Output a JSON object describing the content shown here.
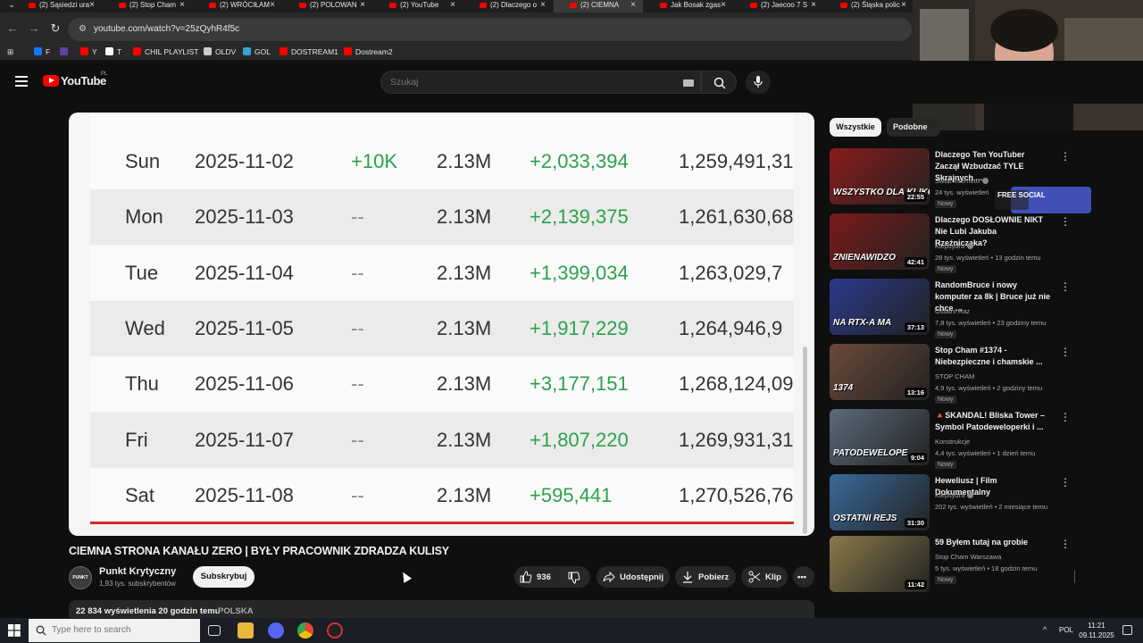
{
  "browser": {
    "tabs": [
      {
        "title": "(2) Sąsiedzi ura"
      },
      {
        "title": "(2) Stop Cham"
      },
      {
        "title": "(2) WRÓCIŁAM"
      },
      {
        "title": "(2) POLOWAN"
      },
      {
        "title": "(2) YouTube"
      },
      {
        "title": "(2) Dlaczego o"
      },
      {
        "title": "(2) CIEMNA"
      },
      {
        "title": "Jak Bosak zgas"
      },
      {
        "title": "(2) Jaecoo 7 S"
      },
      {
        "title": "(2) Śląska polic"
      }
    ],
    "url": "youtube.com/watch?v=25zQyhR4f5c",
    "bookmarks": [
      {
        "label": "F",
        "color": "#1877f2"
      },
      {
        "label": "",
        "color": "#6441a5"
      },
      {
        "label": "Y",
        "color": "#ff0000"
      },
      {
        "label": "T",
        "color": "#ffffff"
      },
      {
        "label": "CHIL PLAYLIST",
        "color": "#ff0000"
      },
      {
        "label": "OLDV",
        "color": "#cccccc"
      },
      {
        "label": "GOL",
        "color": "#3aa0d6"
      },
      {
        "label": "DOSTREAM1",
        "color": "#ff0000"
      },
      {
        "label": "Dostream2",
        "color": "#ff0000"
      }
    ]
  },
  "youtube": {
    "wordmark": "YouTube",
    "region": "PL",
    "search_placeholder": "Szukaj"
  },
  "player": {
    "rows": [
      {
        "day": "Sun",
        "date": "2025-11-02",
        "subs_change": "+10K",
        "subs_total": "2.13M",
        "views_change": "+2,033,394",
        "views_total": "1,259,491,31"
      },
      {
        "day": "Mon",
        "date": "2025-11-03",
        "subs_change": "--",
        "subs_total": "2.13M",
        "views_change": "+2,139,375",
        "views_total": "1,261,630,68"
      },
      {
        "day": "Tue",
        "date": "2025-11-04",
        "subs_change": "--",
        "subs_total": "2.13M",
        "views_change": "+1,399,034",
        "views_total": "1,263,029,7"
      },
      {
        "day": "Wed",
        "date": "2025-11-05",
        "subs_change": "--",
        "subs_total": "2.13M",
        "views_change": "+1,917,229",
        "views_total": "1,264,946,9"
      },
      {
        "day": "Thu",
        "date": "2025-11-06",
        "subs_change": "--",
        "subs_total": "2.13M",
        "views_change": "+3,177,151",
        "views_total": "1,268,124,09"
      },
      {
        "day": "Fri",
        "date": "2025-11-07",
        "subs_change": "--",
        "subs_total": "2.13M",
        "views_change": "+1,807,220",
        "views_total": "1,269,931,31"
      },
      {
        "day": "Sat",
        "date": "2025-11-08",
        "subs_change": "--",
        "subs_total": "2.13M",
        "views_change": "+595,441",
        "views_total": "1,270,526,76"
      }
    ]
  },
  "video": {
    "title": "CIEMNA STRONA KANAŁU ZERO | BYŁY PRACOWNIK ZDRADZA KULISY",
    "channel_name": "Punkt Krytyczny",
    "channel_avatar_text": "PUNKT KRYTYCZNY",
    "channel_subs": "1,93 tys. subskrybentów",
    "subscribe_label": "Subskrybuj",
    "likes": "936",
    "share_label": "Udostępnij",
    "download_label": "Pobierz",
    "clip_label": "Klip",
    "more_label": "•••",
    "views_date": "22 834 wyświetlenia  20 godzin temu",
    "tag": "POLSKA"
  },
  "sidebar": {
    "chips": [
      "Wszystkie",
      "Podobne"
    ],
    "items": [
      {
        "title": "Dlaczego Ten YouTuber Zaczął Wzbudzać TYLE Skrajnych ...",
        "channel": "Świat Internetu",
        "verified": true,
        "meta": "24 tys. wyświetleń",
        "badge": "Nowy",
        "duration": "22:55",
        "thumb_text": "WSZYSTKO DLA KLIKÓW",
        "thumb_color": "#8a1b1b"
      },
      {
        "title": "Dlaczego DOSŁOWNIE NIKT Nie Lubi Jakuba Rzeźniczaka?",
        "channel": "Klepsydra",
        "verified": true,
        "meta": "28 tys. wyświetleń • 13 godzin temu",
        "badge": "Nowy",
        "duration": "42:41",
        "thumb_text": "ZNIENAWIDZO",
        "thumb_color": "#7a1a1a"
      },
      {
        "title": "RandomBruce i nowy komputer za 8k | Bruce już nie chce ...",
        "channel": "Ostatni Raz",
        "verified": false,
        "meta": "7,8 tys. wyświetleń • 23 godziny temu",
        "badge": "Nowy",
        "duration": "37:13",
        "thumb_text": "NA RTX-A MA",
        "thumb_color": "#2b3a8a"
      },
      {
        "title": "Stop Cham #1374 - Niebezpieczne i chamskie ...",
        "channel": "STOP CHAM",
        "verified": false,
        "meta": "4,9 tys. wyświetleń • 2 godziny temu",
        "badge": "Nowy",
        "duration": "13:16",
        "thumb_text": "1374",
        "thumb_color": "#6b4a3a"
      },
      {
        "title": "🔺SKANDAL! Bliska Tower – Symbol Patodeweloperki i ...",
        "channel": "Konstrukcje",
        "verified": false,
        "meta": "4,4 tys. wyświetleń • 1 dzień temu",
        "badge": "Nowy",
        "duration": "9:04",
        "thumb_text": "PATODEWELOPE",
        "thumb_color": "#5c6a7a"
      },
      {
        "title": "Heweliusz | Film Dokumentalny",
        "channel": "Klepsydra",
        "verified": true,
        "meta": "202 tys. wyświetleń • 2 miesiące temu",
        "badge": "",
        "duration": "31:30",
        "thumb_text": "OSTATNI REJS",
        "thumb_color": "#3a6a9a"
      },
      {
        "title": "59 Byłem tutaj na grobie",
        "channel": "Stop Cham Warszawa",
        "verified": false,
        "meta": "5 tys. wyświetleń • 18 godzin temu",
        "badge": "Nowy",
        "duration": "11:42",
        "thumb_text": "",
        "thumb_color": "#8a7a4a"
      }
    ]
  },
  "overlay": {
    "free_social": "FREE SOCIAL"
  },
  "taskbar": {
    "search_placeholder": "Type here to search",
    "lang": "POL",
    "time": "11:21",
    "date": "09.11.2025"
  }
}
